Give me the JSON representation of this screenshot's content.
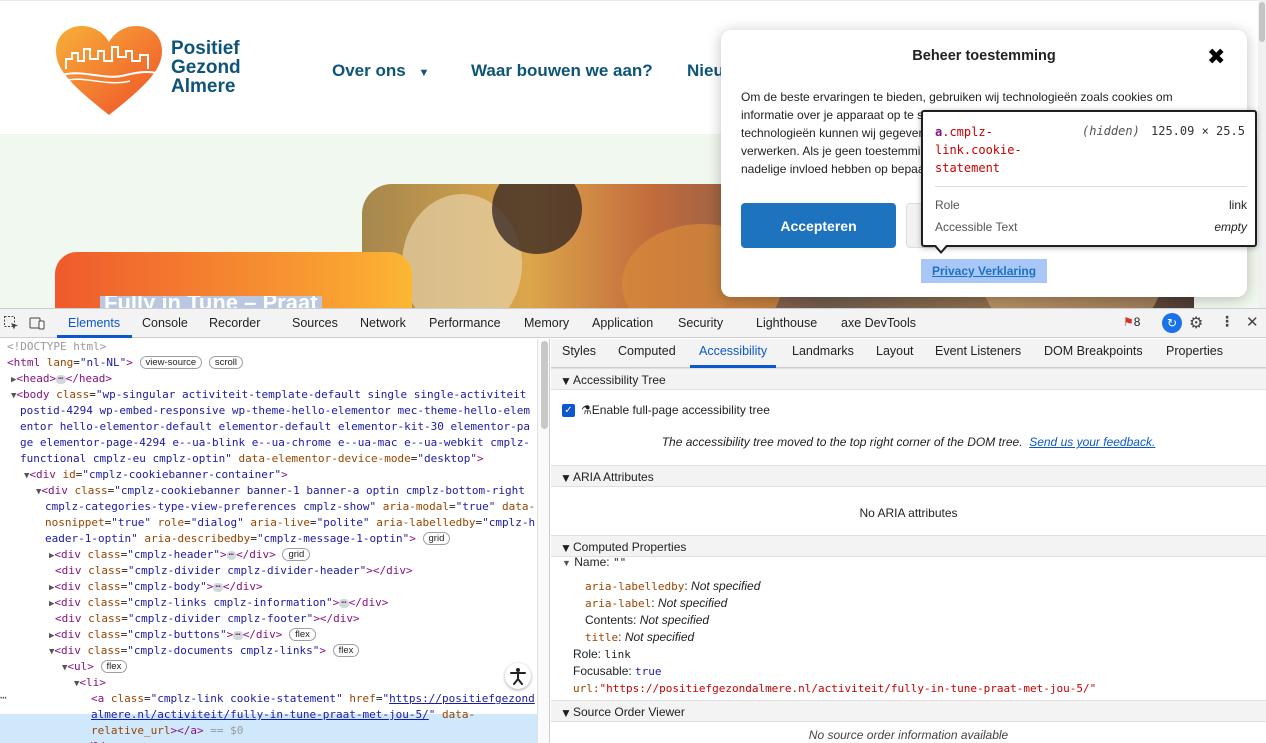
{
  "site": {
    "logo_lines": [
      "Positief",
      "Gezond",
      "Almere"
    ],
    "nav": [
      "Over ons",
      "Waar bouwen we aan?",
      "Nieu"
    ],
    "hero_title": "Fully in Tune – Praat"
  },
  "cookie": {
    "title": "Beheer toestemming",
    "close": "✖",
    "message": "Om de beste ervaringen te bieden, gebruiken wij technologieën zoals cookies om informatie over je apparaat op te slaan en/of te openen. Door in te stemmen met deze technologieën kunnen wij gegevens zoals surfgedrag of unieke ID's op deze site verwerken. Als je geen toestemming geeft of je toestemming intrekt, kan dit een nadelige invloed hebben op bepaalde functies en mogelijkheden.",
    "accept": "Accepteren",
    "privacy": "Privacy Verklaring"
  },
  "tooltip": {
    "tag": "a",
    "selector": ".cmplz-link.cookie-statement",
    "hidden": "(hidden)",
    "size": "125.09 × 25.5",
    "role_label": "Role",
    "role_value": "link",
    "text_label": "Accessible Text",
    "text_value": "empty"
  },
  "devtools": {
    "tabs": [
      "Elements",
      "Console",
      "Recorder",
      "Sources",
      "Network",
      "Performance",
      "Memory",
      "Application",
      "Security",
      "Lighthouse",
      "axe DevTools"
    ],
    "issues_count": "8",
    "side_tabs": [
      "Styles",
      "Computed",
      "Accessibility",
      "Landmarks",
      "Layout",
      "Event Listeners",
      "DOM Breakpoints",
      "Properties"
    ],
    "elements": {
      "doctype": "<!DOCTYPE html>",
      "html_lang": "nl-NL",
      "badge_view_source": "view-source",
      "badge_scroll": "scroll",
      "badge_grid": "grid",
      "badge_flex": "flex",
      "body_class": "wp-singular activiteit-template-default single single-activiteit postid-4294 wp-embed-responsive wp-theme-hello-elementor mec-theme-hello-elementor hello-elementor-default elementor-default elementor-kit-30 elementor-page elementor-page-4294 e--ua-blink e--ua-chrome e--ua-mac e--ua-webkit cmplz-functional cmplz-eu cmplz-optin",
      "body_mode": "desktop",
      "container_id": "cmplz-cookiebanner-container",
      "banner_class": "cmplz-cookiebanner banner-1 banner-a optin cmplz-bottom-right cmplz-categories-type-view-preferences cmplz-show",
      "banner_attrs": {
        "aria-modal": "true",
        "data-nosnippet": "true",
        "role": "dialog",
        "aria-live": "polite",
        "aria-labelledby": "cmplz-header-1-optin",
        "aria-describedby": "cmplz-message-1-optin"
      },
      "children": [
        "cmplz-header",
        "cmplz-divider cmplz-divider-header",
        "cmplz-body",
        "cmplz-links cmplz-information",
        "cmplz-divider cmplz-footer",
        "cmplz-buttons",
        "cmplz-documents cmplz-links"
      ],
      "link_class": "cmplz-link cookie-statement",
      "link_href": "https://positiefgezondalmere.nl/activiteit/fully-in-tune-praat-met-jou-5/",
      "link_extra": "data-relative_url",
      "sel_marker": "== $0"
    },
    "a11y": {
      "tree_header": "Accessibility Tree",
      "enable_label": "Enable full-page accessibility tree",
      "moved_note": "The accessibility tree moved to the top right corner of the DOM tree.",
      "feedback": "Send us your feedback.",
      "aria_header": "ARIA Attributes",
      "aria_empty": "No ARIA attributes",
      "computed_header": "Computed Properties",
      "name_label": "Name:",
      "name_value": "\"\"",
      "labelledby_key": "aria-labelledby",
      "label_key": "aria-label",
      "contents_key": "Contents",
      "title_key": "title",
      "not_specified": "Not specified",
      "role_key": "Role:",
      "role_value": "link",
      "focusable_key": "Focusable:",
      "focusable_value": "true",
      "url_key": "url:",
      "url_value": "\"https://positiefgezondalmere.nl/activiteit/fully-in-tune-praat-met-jou-5/\"",
      "source_header": "Source Order Viewer",
      "source_empty": "No source order information available"
    }
  },
  "colors": {
    "brand": "#0e5479",
    "accent": "#1e73be",
    "devtools_blue": "#0b57d0"
  }
}
